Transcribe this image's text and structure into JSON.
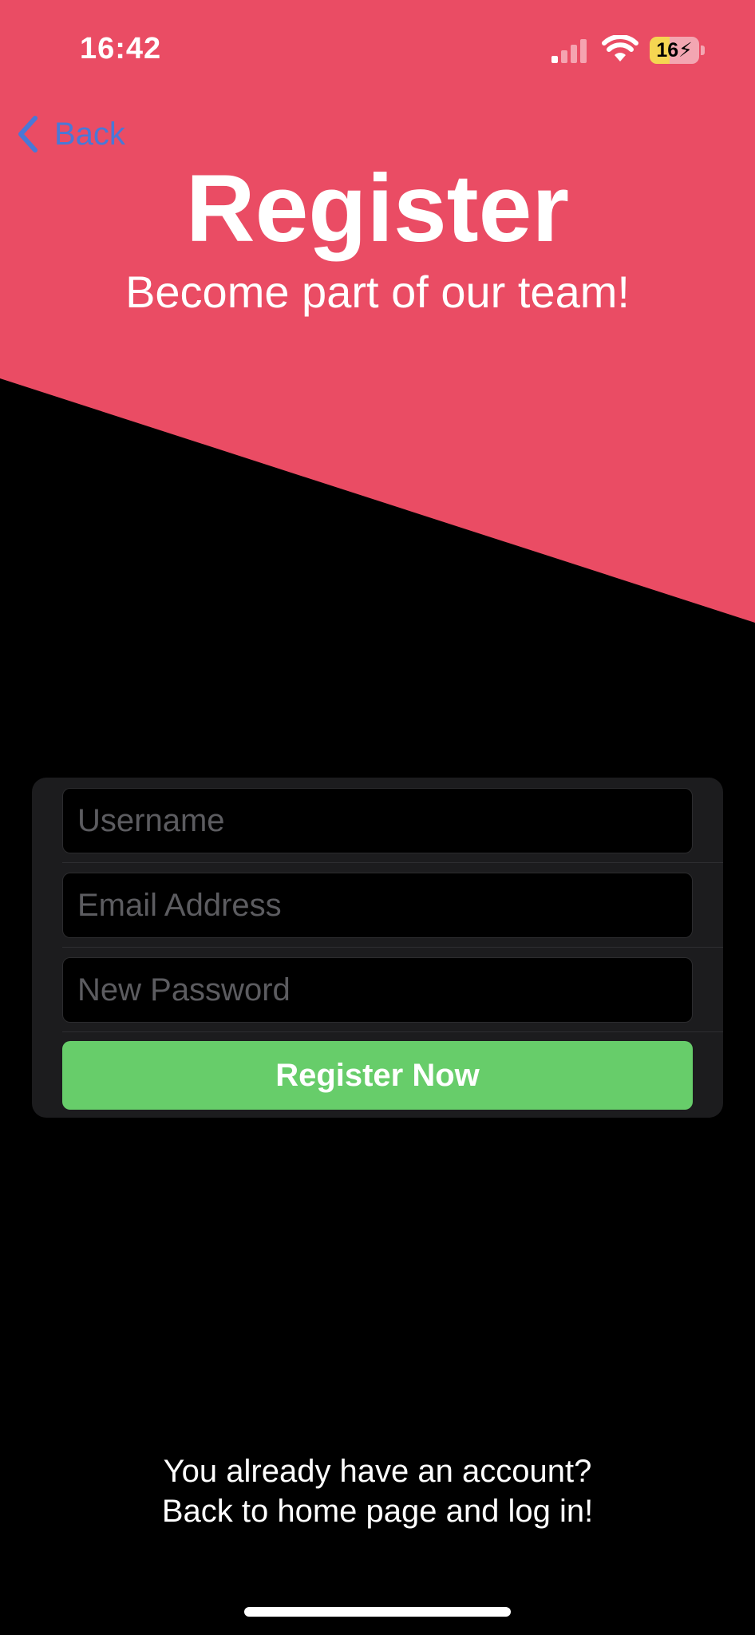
{
  "status_bar": {
    "time": "16:42",
    "battery_level": "16",
    "icons": [
      "signal-icon",
      "wifi-icon",
      "battery-charging-icon"
    ]
  },
  "nav": {
    "back_label": "Back",
    "back_icon": "chevron-left-icon"
  },
  "header": {
    "title": "Register",
    "subtitle": "Become part of our team!"
  },
  "form": {
    "username_placeholder": "Username",
    "username_value": "",
    "email_placeholder": "Email Address",
    "email_value": "",
    "password_placeholder": "New Password",
    "password_value": "",
    "submit_label": "Register Now"
  },
  "footer": {
    "line1": "You already have an account?",
    "line2": "Back to home page and log in!"
  },
  "colors": {
    "banner": "#ea4c64",
    "background": "#000000",
    "card": "#1c1c1e",
    "button": "#67cd6a",
    "link": "#4a78d6"
  }
}
